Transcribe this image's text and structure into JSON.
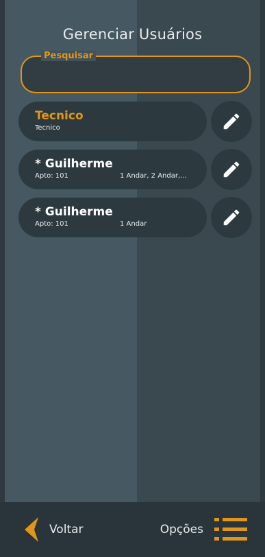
{
  "header": {
    "title": "Gerenciar Usuários"
  },
  "search": {
    "label": "Pesquisar",
    "value": ""
  },
  "users": [
    {
      "name": "Tecnico",
      "sub": "Tecnico",
      "floors": "",
      "highlight": true
    },
    {
      "name": "* Guilherme",
      "sub": "Apto: 101",
      "floors": "1 Andar, 2 Andar,...",
      "highlight": false
    },
    {
      "name": "* Guilherme",
      "sub": "Apto: 101",
      "floors": "1 Andar",
      "highlight": false
    }
  ],
  "footer": {
    "back_label": "Voltar",
    "options_label": "Opções"
  },
  "colors": {
    "accent": "#e0961a",
    "card": "#2c3a40",
    "text": "#e8ecee"
  },
  "icons": {
    "edit": "pencil-icon",
    "back": "chevron-left-icon",
    "options": "list-menu-icon"
  }
}
